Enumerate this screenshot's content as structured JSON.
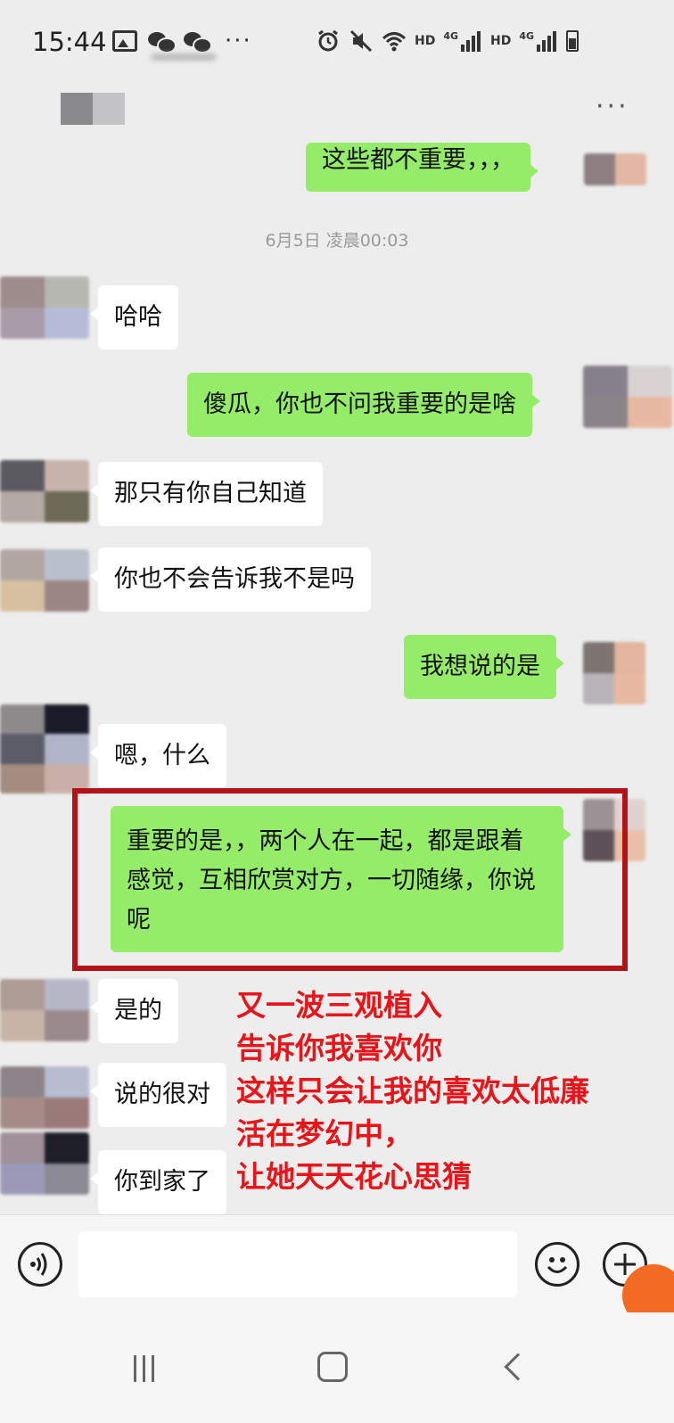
{
  "status_bar": {
    "time": "15:44",
    "left_icons": [
      "image-icon",
      "wechat-icon",
      "wechat-icon"
    ],
    "more": "···",
    "hd1": "HD",
    "net1": "4G",
    "hd2": "HD",
    "net2": "4G"
  },
  "header": {
    "more": "···"
  },
  "chat": {
    "timestamp": "6月5日 凌晨00:03",
    "messages": [
      {
        "side": "right",
        "text": "这些都不重要，，，"
      },
      {
        "side": "left",
        "text": "哈哈"
      },
      {
        "side": "right",
        "text": "傻瓜，你也不问我重要的是啥"
      },
      {
        "side": "left",
        "text": "那只有你自己知道"
      },
      {
        "side": "left",
        "text": "你也不会告诉我不是吗"
      },
      {
        "side": "right",
        "text": "我想说的是"
      },
      {
        "side": "left",
        "text": "嗯，什么"
      },
      {
        "side": "right",
        "text": "重要的是，，两个人在一起，都是跟着感觉，互相欣赏对方，一切随缘，你说呢"
      },
      {
        "side": "left",
        "text": "是的"
      },
      {
        "side": "left",
        "text": "说的很对"
      },
      {
        "side": "left",
        "text": "你到家了"
      }
    ]
  },
  "annotation": {
    "lines": [
      "又一波三观植入",
      "告诉你我喜欢你",
      "这样只会让我的喜欢太低廉",
      "活在梦幻中，",
      "让她天天花心思猜"
    ]
  },
  "colors": {
    "background": "#ededed",
    "bubble_sent": "#95ec69",
    "bubble_received": "#ffffff",
    "annotation_red": "#e8141a",
    "highlight_border": "#b31217"
  }
}
